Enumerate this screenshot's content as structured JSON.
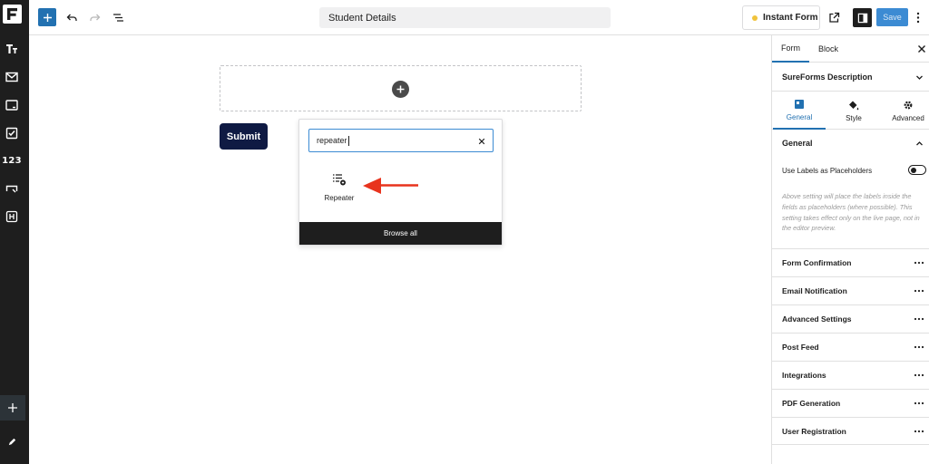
{
  "topbar": {
    "document_title": "Student Details",
    "instant_form_label": "Instant Form",
    "save_label": "Save",
    "colors": {
      "primary": "#2271b1",
      "save": "#3c8bd3",
      "indicator": "#f0c33c"
    }
  },
  "rail": {
    "icons": [
      "forms-logo-icon",
      "text-format-icon",
      "mail-icon",
      "input-field-icon",
      "checkbox-icon",
      "number-icon",
      "button-icon",
      "heading-icon",
      "add-icon",
      "edit-icon"
    ],
    "number_label": "123"
  },
  "canvas": {
    "submit_label": "Submit",
    "inserter": {
      "search_value": "repeater",
      "result_label": "Repeater",
      "browse_all_label": "Browse all"
    }
  },
  "sidebar": {
    "tabs": [
      "Form",
      "Block"
    ],
    "active_tab": "Form",
    "description_label": "SureForms Description",
    "subtabs": [
      "General",
      "Style",
      "Advanced"
    ],
    "active_subtab": "General",
    "general_heading": "General",
    "toggle_label": "Use Labels as Placeholders",
    "toggle_on": false,
    "help_text": "Above setting will place the labels inside the fields as placeholders (where possible). This setting takes effect only on the live page, not in the editor preview.",
    "panels": [
      "Form Confirmation",
      "Email Notification",
      "Advanced Settings",
      "Post Feed",
      "Integrations",
      "PDF Generation",
      "User Registration"
    ]
  }
}
